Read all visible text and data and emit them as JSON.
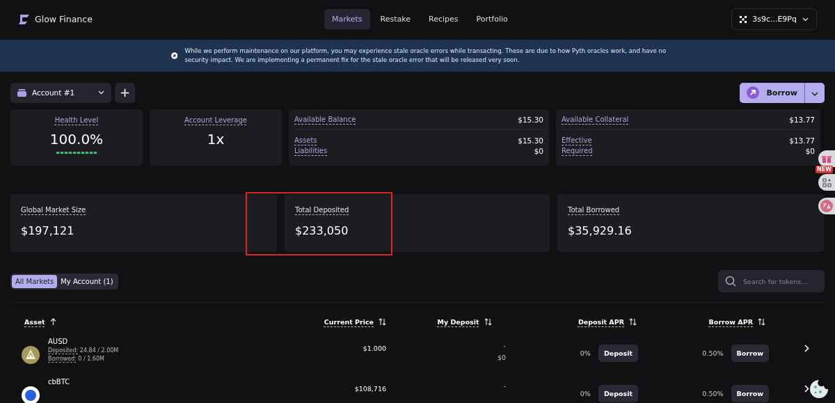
{
  "brand": "Glow Finance",
  "nav": [
    {
      "label": "Markets",
      "selected": true
    },
    {
      "label": "Restake",
      "selected": false
    },
    {
      "label": "Recipes",
      "selected": false
    },
    {
      "label": "Portfolio",
      "selected": false
    }
  ],
  "wallet": "3s9c...E9Pq",
  "banner": "While we perform maintenance on our platform, you may experience stale oracle errors while transacting. These are due to how Pyth oracles work, and have no security impact. We are implementing a permanent fix for the stale oracle error that will be released very soon.",
  "account": "Account #1",
  "add_button": "+",
  "borrow_button": "Borrow",
  "health": {
    "label": "Health Level",
    "value": "100.0%",
    "level": 1
  },
  "leverage": {
    "label": "Account Leverage",
    "value": "1x"
  },
  "balance_cards": [
    {
      "title": "Available Balance",
      "total": "$15.30",
      "rows": [
        {
          "label": "Assets",
          "value": "$15.30"
        },
        {
          "label": "Liabilities",
          "value": "$0"
        }
      ]
    },
    {
      "title": "Available Collateral",
      "total": "$13.77",
      "rows": [
        {
          "label": "Effective",
          "value": "$13.77"
        },
        {
          "label": "Required",
          "value": "$0"
        }
      ]
    }
  ],
  "stats": [
    {
      "label": "Global Market Size",
      "value": "$197,121",
      "highlighted": false
    },
    {
      "label": "Total Deposited",
      "value": "$233,050",
      "highlighted": true
    },
    {
      "label": "Total Borrowed",
      "value": "$35,929.16",
      "highlighted": false
    }
  ],
  "filters": [
    {
      "label": "All Markets",
      "selected": true
    },
    {
      "label": "My Account (1)",
      "selected": false
    }
  ],
  "search": {
    "placeholder": "Search for tokens..."
  },
  "table": {
    "columns": [
      {
        "label": "Asset",
        "sorted_ascending": true
      },
      {
        "label": "Current Price",
        "sorted_ascending": false
      },
      {
        "label": "My Deposit",
        "sorted_ascending": false
      },
      {
        "label": "Deposit APR",
        "sorted_ascending": false
      },
      {
        "label": "Borrow APR",
        "sorted_ascending": false
      }
    ],
    "rows": [
      {
        "asset": "AUSD",
        "kind": "ausd",
        "deposited_label": "Deposited:",
        "deposited": "24.84 / 2.00M",
        "borrowed_label": "Borrowed:",
        "borrowed": "0 / 1.60M",
        "price": "$1.000",
        "my_deposit": "-",
        "my_deposit_usd": "$0",
        "deposit_apr": "0%",
        "deposit_button": "Deposit",
        "borrow_apr": "0.50%",
        "borrow_button": "Borrow"
      },
      {
        "asset": "cbBTC",
        "kind": "btc",
        "price": "$108,716",
        "my_deposit": "-",
        "deposit_apr": "0%",
        "deposit_button": "Deposit",
        "borrow_apr": "0.50%",
        "borrow_button": "Borrow"
      }
    ]
  },
  "side_badge": "NEW"
}
